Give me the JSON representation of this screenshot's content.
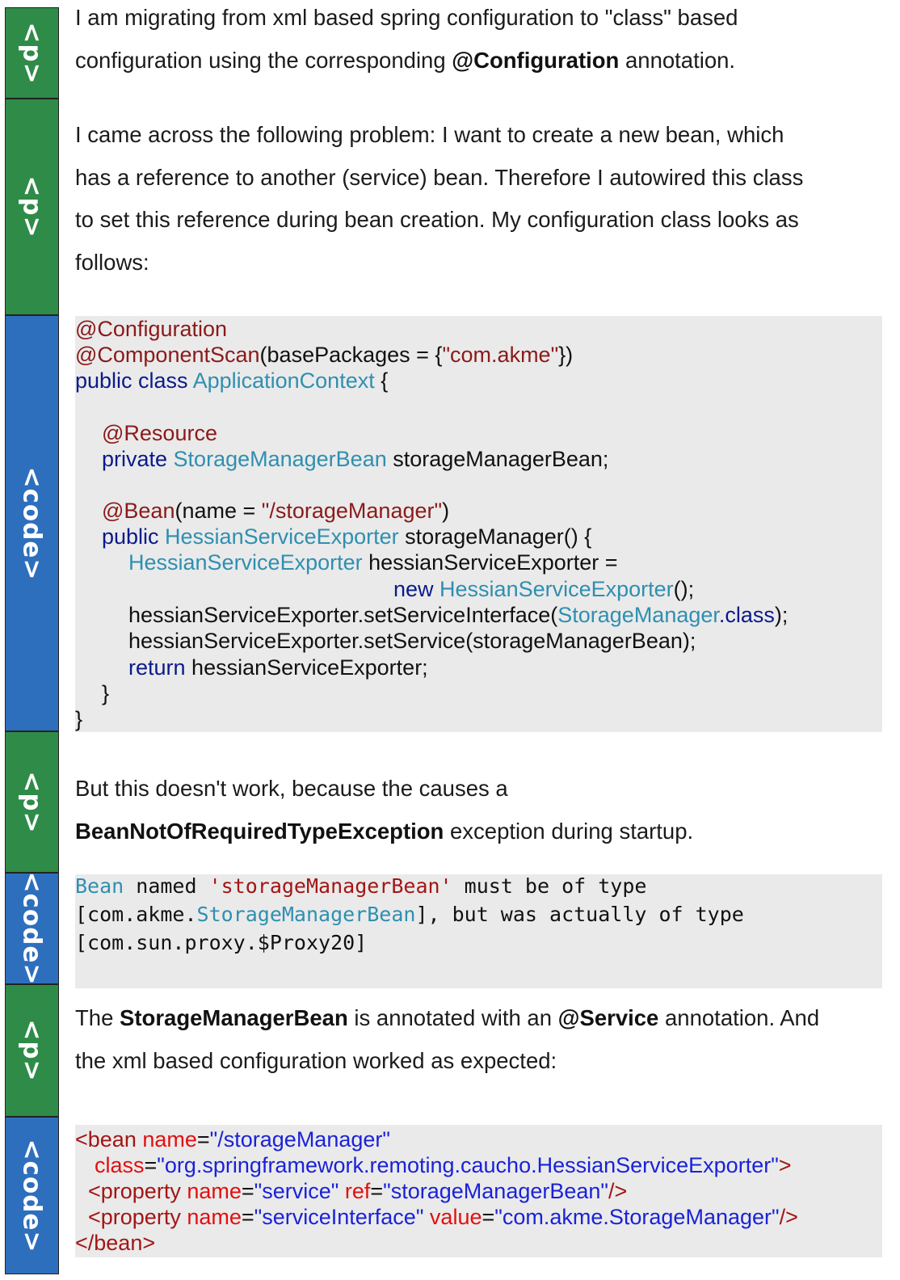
{
  "tags": {
    "p": "<p>",
    "code": "<code>"
  },
  "p1": {
    "line1": "I am migrating from xml based spring configuration to \"class\" based",
    "line2_before": "configuration using the corresponding ",
    "line2_bold": "@Configuration",
    "line2_after": " annotation."
  },
  "p2": {
    "lines": [
      "I  came across the following problem: I want to create a new bean, which",
      "has a reference to another (service) bean. Therefore I autowired this class",
      "to set this reference during bean creation. My configuration class looks as",
      "follows:"
    ]
  },
  "code1": {
    "l1": {
      "ann": "@Configuration"
    },
    "l2": {
      "ann": "@ComponentScan",
      "t1": "(basePackages = {",
      "str": "\"com.akme\"",
      "t2": "})"
    },
    "l3": {
      "kw": "public class ",
      "ty": "ApplicationContext",
      "t": " {"
    },
    "l4": {
      "ann": "@Resource"
    },
    "l5": {
      "kw": "private ",
      "ty": "StorageManagerBean",
      "t": " storageManagerBean;"
    },
    "l6": {
      "ann": "@Bean",
      "t1": "(name = ",
      "str": "\"/storageManager\"",
      "t2": ")"
    },
    "l7": {
      "kw": "public ",
      "ty": "HessianServiceExporter",
      "t": " storageManager() {"
    },
    "l8": {
      "ty": "HessianServiceExporter",
      "t": " hessianServiceExporter ="
    },
    "l9": {
      "kw": "new ",
      "ty": "HessianServiceExporter",
      "t": "();"
    },
    "l10": {
      "t1": "hessianServiceExporter.setServiceInterface(",
      "ty": "StorageManager",
      "kw": ".class",
      "t2": ");"
    },
    "l11": {
      "t": "hessianServiceExporter.setService(storageManagerBean);"
    },
    "l12": {
      "kw": "return",
      "t": " hessianServiceExporter;"
    },
    "l13": {
      "t": "}"
    },
    "l14": {
      "t": "}"
    }
  },
  "p3": {
    "line1": "But this doesn't work, because the causes a",
    "line2_bold": "BeanNotOfRequiredTypeException",
    "line2_after": " exception during startup."
  },
  "code2": {
    "l1": {
      "ty": "Bean",
      "t1": " named ",
      "str": "'storageManagerBean'",
      "t2": " must be of type"
    },
    "l2": {
      "t1": "[com.akme.",
      "ty": "StorageManagerBean",
      "t2": "], but was actually of type"
    },
    "l3": {
      "t": "[com.sun.proxy.$Proxy20]"
    }
  },
  "p4": {
    "l1_a": "The ",
    "l1_b1": "StorageManagerBean",
    "l1_c": " is annotated with an ",
    "l1_b2": "@Service",
    "l1_d": " annotation. And",
    "line2": "the xml based configuration worked as expected:"
  },
  "code3": {
    "l1": {
      "tag": "<bean ",
      "attr": "name",
      "eq": "=",
      "val": "\"/storageManager\""
    },
    "l2": {
      "attr": "class",
      "eq": "=",
      "val": "\"org.springframework.remoting.caucho.HessianServiceExporter\"",
      "tag": ">"
    },
    "l3": {
      "tag": "<property ",
      "a1": "name",
      "eq1": "=",
      "v1": "\"service\"",
      "a2": " ref",
      "eq2": "=",
      "v2": "\"storageManagerBean\"",
      "end": "/>"
    },
    "l4": {
      "tag": "<property ",
      "a1": "name",
      "eq1": "=",
      "v1": "\"serviceInterface\"",
      "a2": " value",
      "eq2": "=",
      "v2": "\"com.akme.StorageManager\"",
      "end": "/>"
    },
    "l5": {
      "tag": "</bean>"
    }
  }
}
